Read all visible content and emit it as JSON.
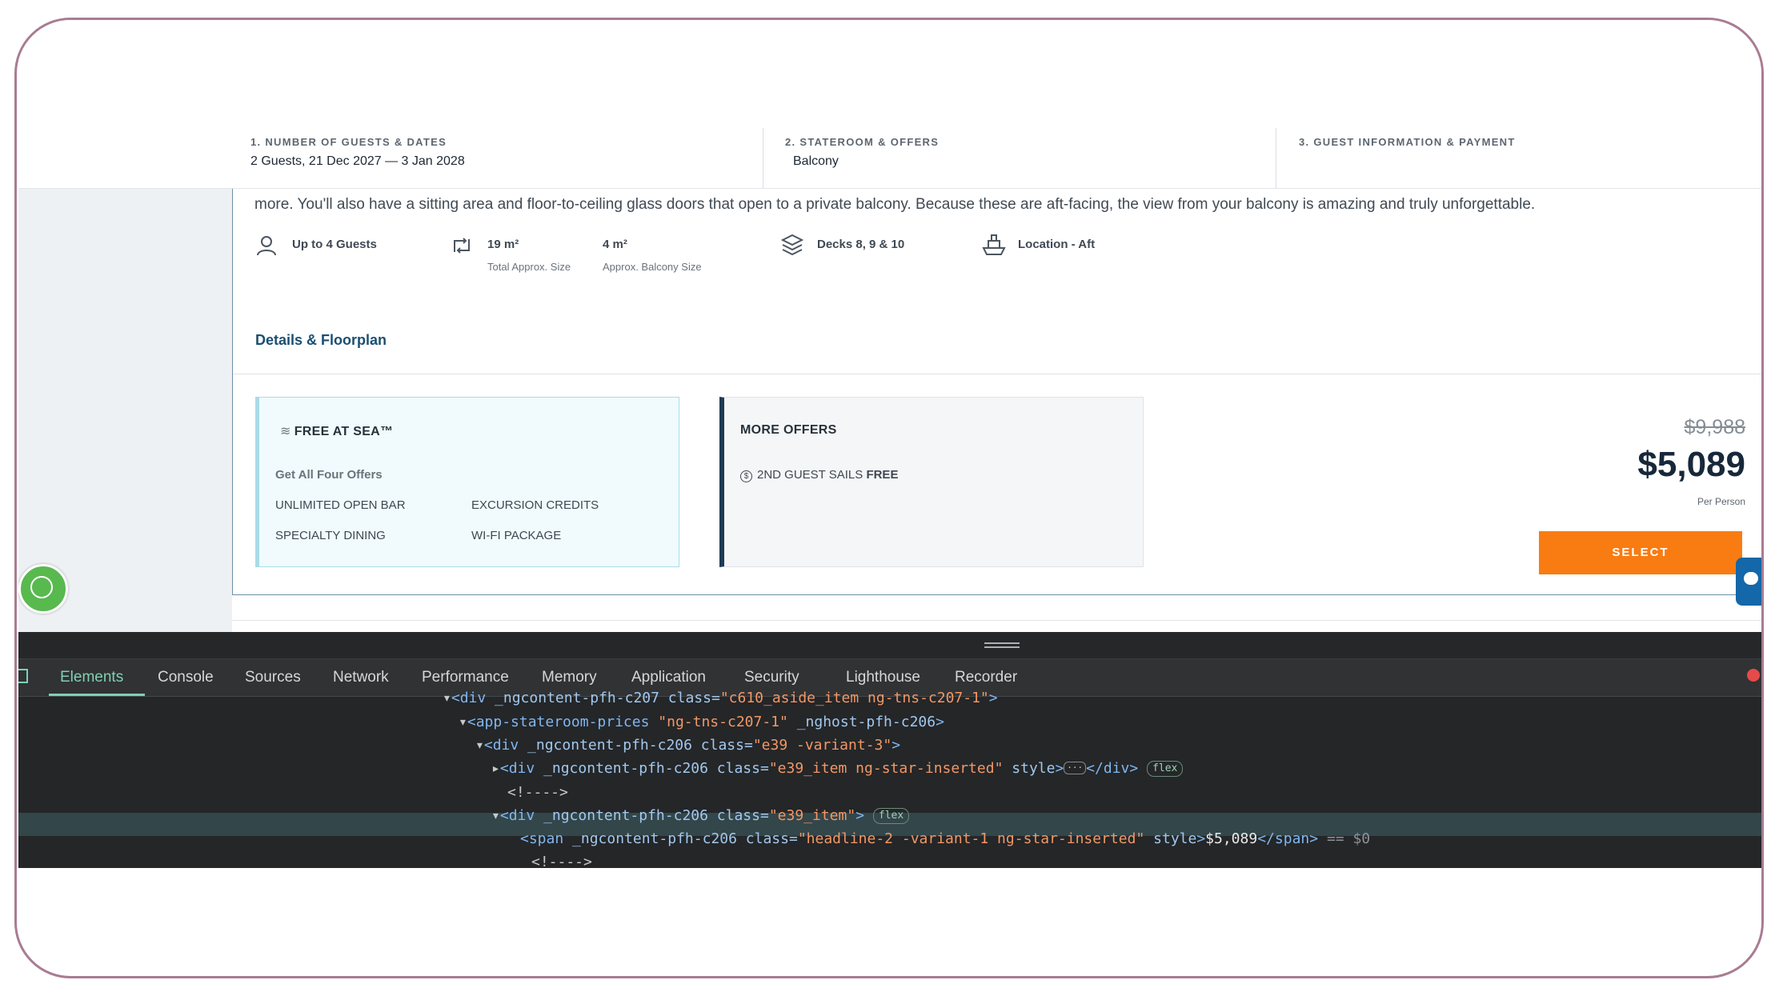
{
  "steps": [
    {
      "label": "1. NUMBER OF GUESTS & DATES",
      "value": "2 Guests,  21 Dec 2027 — 3 Jan 2028"
    },
    {
      "label": "2. STATEROOM & OFFERS",
      "value": "Balcony"
    },
    {
      "label": "3. GUEST INFORMATION & PAYMENT",
      "value": ""
    }
  ],
  "description": "more. You'll also have a sitting area and floor-to-ceiling glass doors that open to a private balcony. Because these are aft-facing, the view from your balcony is amazing and truly unforgettable.",
  "amenities": {
    "guests": "Up to 4 Guests",
    "size": "19 m²",
    "size_sub": "Total Approx. Size",
    "balcony": "4 m²",
    "balcony_sub": "Approx. Balcony Size",
    "decks": "Decks 8, 9 & 10",
    "location": "Location - Aft"
  },
  "details_link": "Details & Floorplan",
  "free_at_sea": {
    "title": "FREE AT SEA™",
    "subtitle": "Get All Four Offers",
    "items": [
      "UNLIMITED OPEN BAR",
      "EXCURSION CREDITS",
      "SPECIALTY DINING",
      "WI-FI PACKAGE"
    ]
  },
  "more_offers": {
    "title": "MORE OFFERS",
    "item_prefix": "2ND GUEST SAILS ",
    "item_bold": "FREE"
  },
  "price": {
    "old": "$9,988",
    "new": "$5,089",
    "per": "Per Person",
    "select": "SELECT"
  },
  "devtools": {
    "tabs": [
      "Elements",
      "Console",
      "Sources",
      "Network",
      "Performance",
      "Memory",
      "Application",
      "Security",
      "Lighthouse",
      "Recorder"
    ],
    "lines": {
      "l0_tag": "div",
      "l0_attr": "_ngcontent-pfh-c207 class=",
      "l0_val": "\"c610_aside_item ng-tns-c207-1\"",
      "l1_tag": "app-stateroom-prices",
      "l1_attr1": "_ngcontent-pfh-c207 class=",
      "l1_val": "\"ng-tns-c207-1\"",
      "l1_attr2": "_nghost-pfh-c206",
      "l2_tag": "div",
      "l2_attr": "_ngcontent-pfh-c206 class=",
      "l2_val": "\"e39 -variant-3\"",
      "l3_tag": "div",
      "l3_attr": "_ngcontent-pfh-c206 class=",
      "l3_val": "\"e39_item ng-star-inserted\"",
      "l3_attr2": "style",
      "l3_close": "div",
      "l4_comment": "<!---->",
      "l5_tag": "div",
      "l5_attr": "_ngcontent-pfh-c206 class=",
      "l5_val": "\"e39_item\"",
      "l6_tag": "span",
      "l6_attr": "_ngcontent-pfh-c206 class=",
      "l6_val": "\"headline-2 -variant-1 ng-star-inserted\"",
      "l6_attr2": "style",
      "l6_text": "$5,089",
      "l6_eq": "== $0",
      "l7_comment": "<!---->",
      "badge": "flex",
      "ellipsis": "···"
    }
  }
}
